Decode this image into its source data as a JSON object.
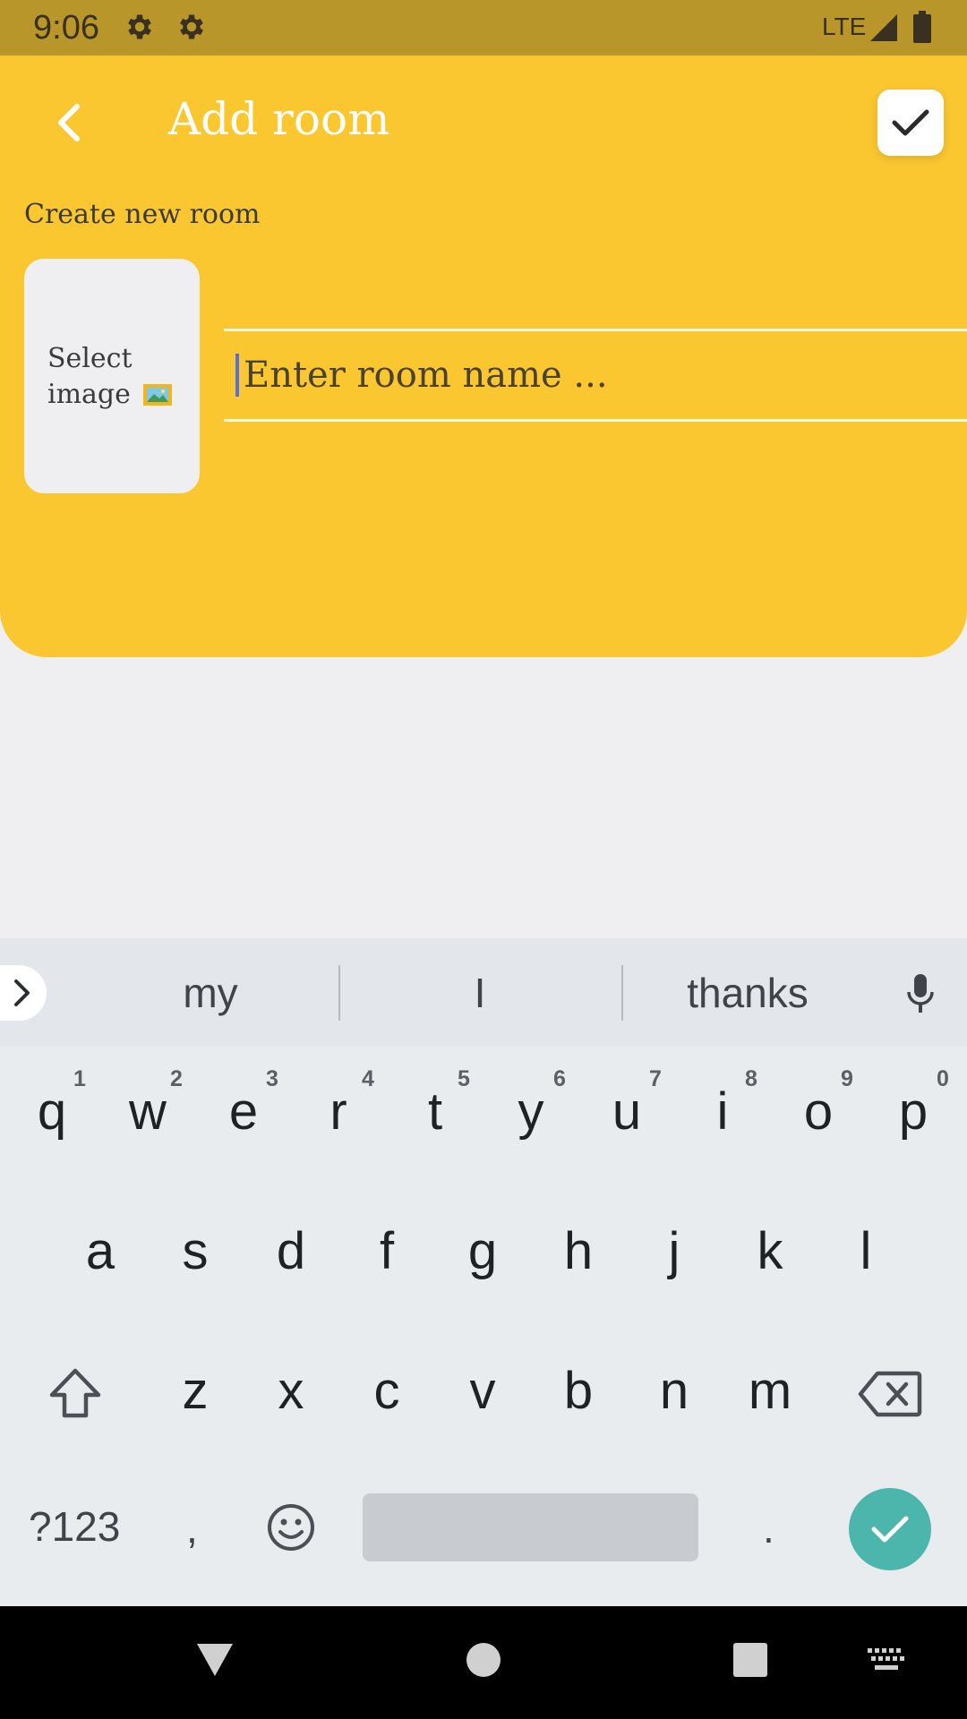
{
  "status_bar": {
    "time": "9:06",
    "network": "LTE",
    "icons": [
      "settings-gear-icon",
      "settings-gear-icon",
      "signal-icon",
      "battery-icon"
    ]
  },
  "header": {
    "title": "Add room",
    "back_icon": "chevron-left-icon",
    "confirm_icon": "checkmark-icon",
    "background_color": "#FAC731"
  },
  "form": {
    "section_label": "Create new room",
    "image_picker_label": "Select image",
    "image_picker_emoji": "picture-emoji-icon",
    "room_name_placeholder": "Enter room name ...",
    "room_name_value": ""
  },
  "keyboard": {
    "suggestions": [
      "my",
      "I",
      "thanks"
    ],
    "row1": [
      {
        "key": "q",
        "num": "1"
      },
      {
        "key": "w",
        "num": "2"
      },
      {
        "key": "e",
        "num": "3"
      },
      {
        "key": "r",
        "num": "4"
      },
      {
        "key": "t",
        "num": "5"
      },
      {
        "key": "y",
        "num": "6"
      },
      {
        "key": "u",
        "num": "7"
      },
      {
        "key": "i",
        "num": "8"
      },
      {
        "key": "o",
        "num": "9"
      },
      {
        "key": "p",
        "num": "0"
      }
    ],
    "row2": [
      "a",
      "s",
      "d",
      "f",
      "g",
      "h",
      "j",
      "k",
      "l"
    ],
    "row3": [
      "z",
      "x",
      "c",
      "v",
      "b",
      "n",
      "m"
    ],
    "symbols_key": "?123",
    "comma_key": ",",
    "period_key": ".",
    "accent_color": "#4DB6AC"
  },
  "nav_bar": {
    "items": [
      "back-triangle-icon",
      "home-circle-icon",
      "recents-square-icon",
      "keyboard-switch-icon"
    ]
  }
}
